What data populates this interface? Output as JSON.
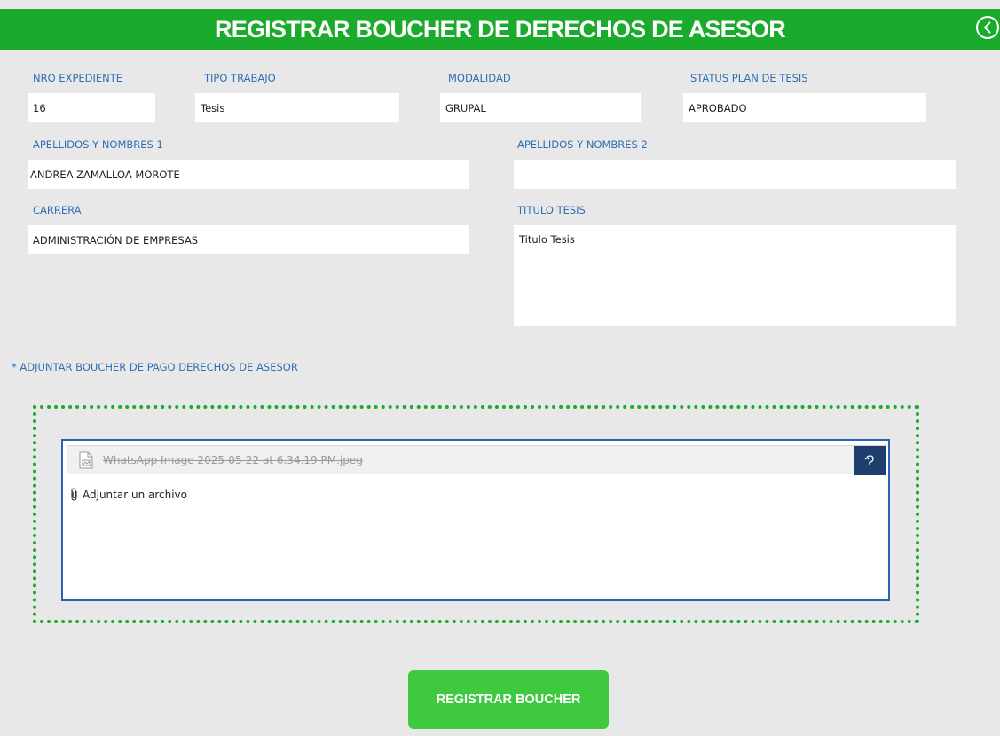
{
  "header": {
    "title": "REGISTRAR BOUCHER DE DERECHOS DE ASESOR",
    "back_icon": "chevron-left-circle-icon"
  },
  "form": {
    "nro_expediente": {
      "label": "NRO EXPEDIENTE",
      "value": "16"
    },
    "tipo_trabajo": {
      "label": "TIPO TRABAJO",
      "value": "Tesis"
    },
    "modalidad": {
      "label": "MODALIDAD",
      "value": "GRUPAL"
    },
    "status_plan": {
      "label": "STATUS PLAN DE TESIS",
      "value": "APROBADO"
    },
    "apellidos1": {
      "label": "APELLIDOS Y NOMBRES 1",
      "value": "ANDREA ZAMALLOA MOROTE"
    },
    "apellidos2": {
      "label": "APELLIDOS Y NOMBRES 2",
      "value": ""
    },
    "carrera": {
      "label": "CARRERA",
      "value": "ADMINISTRACIÓN DE EMPRESAS"
    },
    "titulo_tesis": {
      "label": "TITULO TESIS",
      "value": "Titulo Tesis"
    }
  },
  "attachment": {
    "label": "*   ADJUNTAR BOUCHER DE PAGO DERECHOS DE ASESOR",
    "file_name": "WhatsApp Image 2025-05-22 at 6.34.19 PM.jpeg",
    "add_link": "Adjuntar un archivo",
    "border_color": "#1aaa2c"
  },
  "submit": {
    "label": "REGISTRAR BOUCHER"
  },
  "colors": {
    "header_bg": "#1aaa2c",
    "label": "#2f6fb5",
    "button_bg": "#3ec93e",
    "upload_border": "#2a62b5"
  }
}
